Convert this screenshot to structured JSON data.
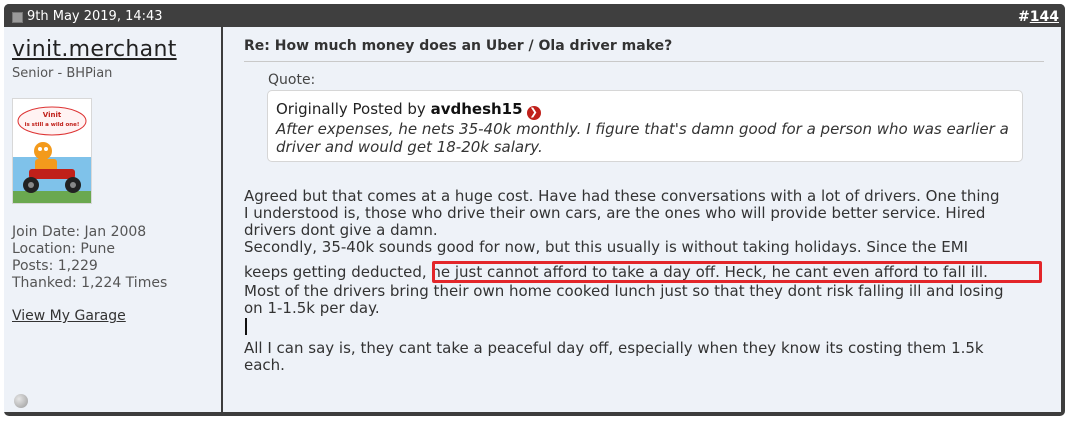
{
  "post": {
    "date": "9th May 2019, 14:43",
    "number_prefix": "#",
    "number": "144"
  },
  "user": {
    "name": "vinit.merchant",
    "title": "Senior - BHPian",
    "avatar_text_line1": "Vinit",
    "avatar_text_line2": "is still a wild one!",
    "join_date": "Join Date: Jan 2008",
    "location": "Location: Pune",
    "posts": "Posts: 1,229",
    "thanked": "Thanked: 1,224 Times",
    "garage_link": "View My Garage"
  },
  "content": {
    "title": "Re: How much money does an Uber / Ola driver make?",
    "quote_label": "Quote:",
    "quote_prefix": "Originally Posted by ",
    "quote_author": "avdhesh15",
    "quote_text": "After expenses, he nets 35-40k monthly. I figure that's damn good for a person who was earlier a driver and would get 18-20k salary.",
    "lines": [
      "Agreed but that comes at a huge cost. Have had these conversations with a lot of drivers. One thing",
      "I understood is, those who drive their own cars, are the ones who will provide better service. Hired",
      "drivers dont give a damn.",
      "Secondly, 35-40k sounds good for now, but this usually is without taking holidays. Since the EMI",
      "keeps getting deducted, he just cannot afford to take a day off. Heck, he cant even afford to fall ill.",
      "Most of the drivers bring their own home cooked lunch just so that they dont risk falling ill and losing",
      "on 1-1.5k per day.",
      "All I can say is, they cant take a peaceful day off, especially when they know its costing them 1.5k",
      "each."
    ]
  },
  "colors": {
    "header_bg": "#3f3f3f",
    "panel_bg": "#eef2f8",
    "highlight_border": "#e3262a"
  }
}
